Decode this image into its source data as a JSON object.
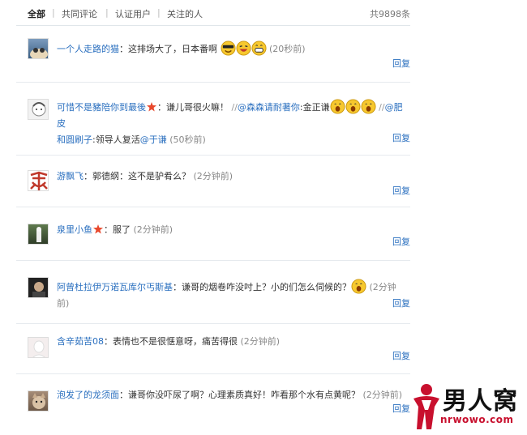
{
  "tabs": {
    "items": [
      {
        "label": "全部"
      },
      {
        "label": "共同评论"
      },
      {
        "label": "认证用户"
      },
      {
        "label": "关注的人"
      }
    ],
    "total": "共9898条"
  },
  "comments": [
    {
      "user": "一个人走路的猫",
      "text": "：这排场大了，日本番啊",
      "time": "(20秒前)",
      "reply": "回复"
    },
    {
      "user": "可惜不是豬陪你到最後",
      "text": "：谦儿哥很火嘛！",
      "repost": "//",
      "at1": "@森森请耐著你",
      "text2": ":金正谦",
      "repost2": "//",
      "at2": "@肥皮",
      "line2_user": "和圆刷子",
      "line2_text": ":领导人复活",
      "at3": "@于谦",
      "time": "(50秒前)",
      "reply": "回复"
    },
    {
      "user": "游飘飞",
      "text": "：郭德纲：这不是驴肴么？",
      "time": "(2分钟前)",
      "reply": "回复"
    },
    {
      "user": "泉里小鱼",
      "text": "：服了",
      "time": "(2分钟前)",
      "reply": "回复"
    },
    {
      "user": "阿曾杜拉伊万诺瓦库尔丐斯基",
      "text": "：谦哥的烟卷咋没吋上？小的们怎么伺候的？",
      "time": "(2分钟前)",
      "reply": "回复"
    },
    {
      "user": "含辛茹苦08",
      "text": "：表情也不是很惬意呀，痛苦得很",
      "time": "(2分钟前)",
      "reply": "回复"
    },
    {
      "user": "泡发了的龙须面",
      "text": "：谦哥你没吓尿了啊？心理素质真好！咋看那个水有点黄呢？",
      "time": "(2分钟前)",
      "reply": "回复"
    }
  ],
  "watermark": {
    "brand": "男人窝",
    "url": "nrwowo.com"
  },
  "colors": {
    "link": "#2a6fbf",
    "rule": "#e6eaee",
    "brand_red": "#c8102e"
  }
}
